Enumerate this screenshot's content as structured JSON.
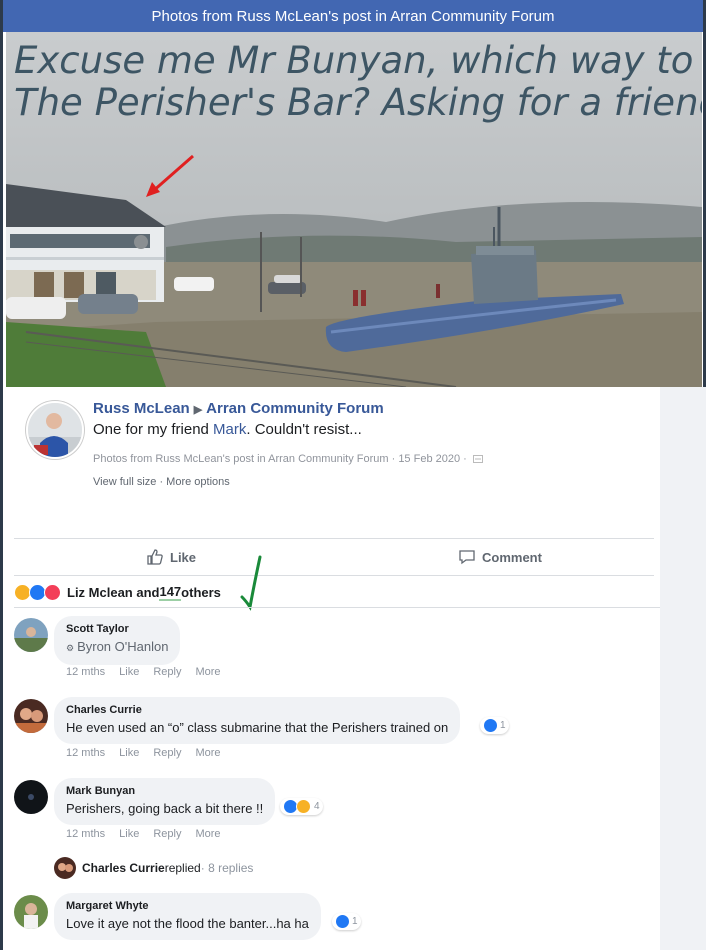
{
  "header": {
    "title": "Photos from Russ McLean's post in Arran Community Forum"
  },
  "photo": {
    "caption_line1": "Excuse me Mr Bunyan, which way to",
    "caption_line2": "The Perisher's Bar? Asking for a friend"
  },
  "post": {
    "author": "Russ McLean",
    "group": "Arran Community Forum",
    "text_before": "One for my friend ",
    "mention": "Mark",
    "text_after": ". Couldn't resist...",
    "meta": "Photos from Russ McLean's post in Arran Community Forum · 15 Feb 2020 ·",
    "view_full": "View full size",
    "sep": " · ",
    "more_options": "More options"
  },
  "actions": {
    "like": "Like",
    "comment": "Comment"
  },
  "reactions": {
    "names": "Liz Mclean and ",
    "count": "147",
    "suffix": " others"
  },
  "comments": [
    {
      "name": "Scott Taylor",
      "text": "Byron O'Hanlon",
      "time": "12 mths",
      "like": "Like",
      "reply": "Reply",
      "more": "More"
    },
    {
      "name": "Charles Currie",
      "text": "He even used an “o” class submarine that the Perishers trained on",
      "reaction_count": "1",
      "time": "12 mths",
      "like": "Like",
      "reply": "Reply",
      "more": "More"
    },
    {
      "name": "Mark Bunyan",
      "text": "Perishers, going back a bit there !!",
      "reaction_count": "4",
      "time": "12 mths",
      "like": "Like",
      "reply": "Reply",
      "more": "More"
    },
    {
      "name": "Margaret Whyte",
      "text": "Love it aye not the flood the banter...ha ha",
      "reaction_count": "1"
    }
  ],
  "replied": {
    "name": "Charles Currie",
    "verb": " replied",
    "count": " · 8 replies"
  },
  "colors": {
    "brand": "#4267b2",
    "link": "#385898",
    "bubble": "#f0f2f5",
    "annotation_red": "#e02020",
    "annotation_green": "#1a8a3a"
  }
}
